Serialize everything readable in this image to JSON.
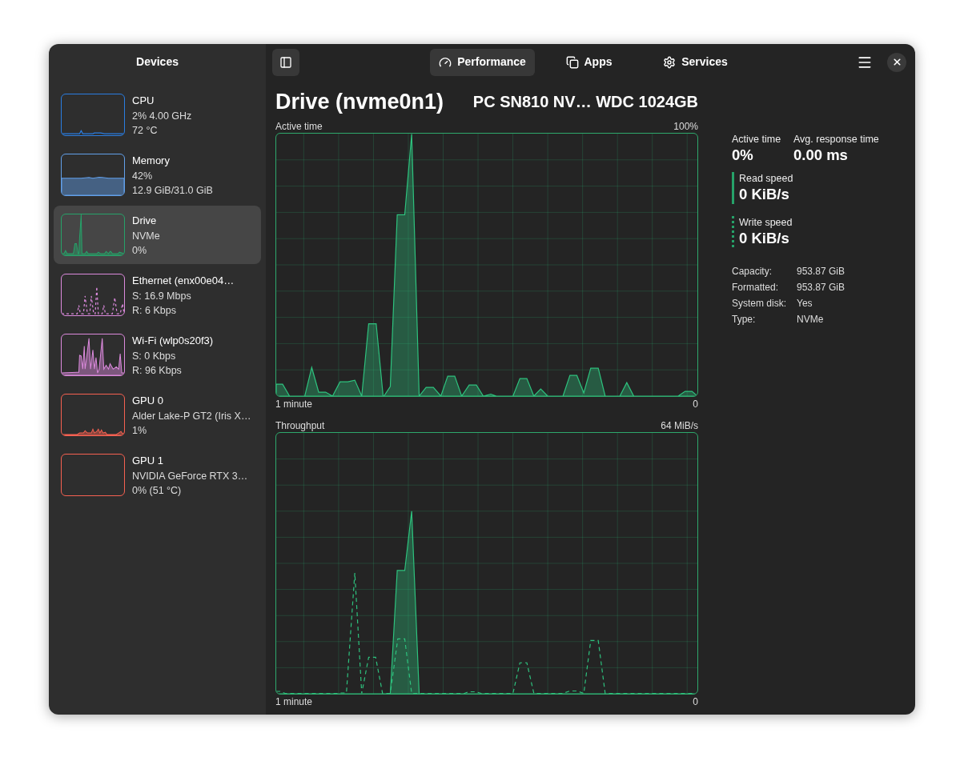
{
  "sidebar": {
    "title": "Devices",
    "items": [
      {
        "name": "CPU",
        "details": [
          "2% 4.00 GHz",
          "72 °C"
        ],
        "color": "#2a7de1",
        "selected": false
      },
      {
        "name": "Memory",
        "details": [
          "42%",
          "12.9 GiB/31.0 GiB"
        ],
        "color": "#62a0ea",
        "selected": false
      },
      {
        "name": "Drive",
        "details": [
          "NVMe",
          "0%"
        ],
        "color": "#26a269",
        "selected": true
      },
      {
        "name": "Ethernet (enx00e04…",
        "details": [
          "S: 16.9 Mbps",
          "R: 6 Kbps"
        ],
        "color": "#dc8add",
        "selected": false
      },
      {
        "name": "Wi-Fi (wlp0s20f3)",
        "details": [
          "S: 0 Kbps",
          "R: 96 Kbps"
        ],
        "color": "#dc8add",
        "selected": false
      },
      {
        "name": "GPU 0",
        "details": [
          "Alder Lake-P GT2 (Iris X…",
          "1%"
        ],
        "color": "#f66151",
        "selected": false
      },
      {
        "name": "GPU 1",
        "details": [
          "NVIDIA GeForce RTX 3…",
          "0% (51 °C)"
        ],
        "color": "#f66151",
        "selected": false
      }
    ]
  },
  "tabs": [
    {
      "label": "Performance",
      "selected": true
    },
    {
      "label": "Apps",
      "selected": false
    },
    {
      "label": "Services",
      "selected": false
    }
  ],
  "header": {
    "title": "Drive (nvme0n1)",
    "subtitle": "PC SN810 NV… WDC 1024GB"
  },
  "graphs": [
    {
      "title": "Active time",
      "max": "100%",
      "start": "1 minute",
      "end": "0"
    },
    {
      "title": "Throughput",
      "max": "64 MiB/s",
      "start": "1 minute",
      "end": "0"
    }
  ],
  "stats": [
    {
      "label": "Active time",
      "value": "0%"
    },
    {
      "label": "Avg. response time",
      "value": "0.00 ms"
    }
  ],
  "speeds": [
    {
      "label": "Read speed",
      "value": "0 KiB/s",
      "kind": "solid"
    },
    {
      "label": "Write speed",
      "value": "0 KiB/s",
      "kind": "dotted"
    }
  ],
  "properties": [
    {
      "label": "Capacity:",
      "value": "953.87 GiB"
    },
    {
      "label": "Formatted:",
      "value": "953.87 GiB"
    },
    {
      "label": "System disk:",
      "value": "Yes"
    },
    {
      "label": "Type:",
      "value": "NVMe"
    }
  ]
}
